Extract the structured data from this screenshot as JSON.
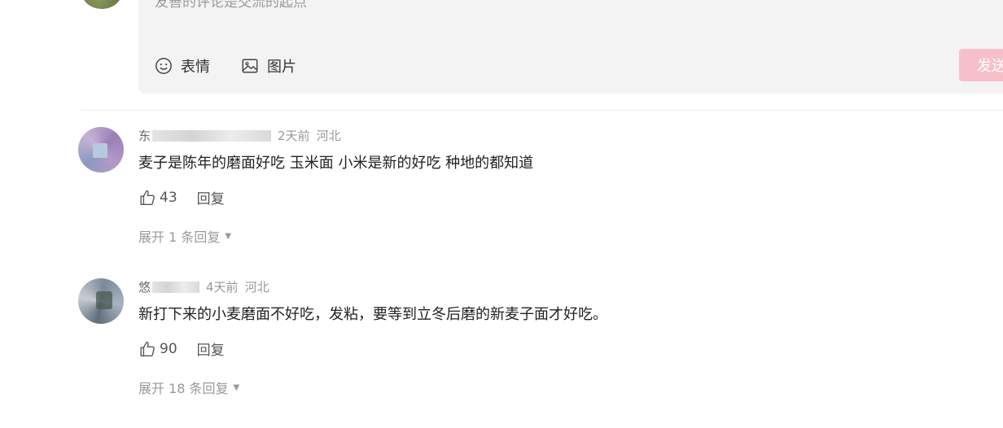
{
  "editor": {
    "placeholder": "友善的评论是交流的起点",
    "tools": [
      {
        "icon": "emoji-icon",
        "label": "表情"
      },
      {
        "icon": "image-icon",
        "label": "图片"
      }
    ],
    "send_label": "发送"
  },
  "comments": [
    {
      "username": "东",
      "time": "2天前",
      "location": "河北",
      "text": "麦子是陈年的磨面好吃 玉米面 小米是新的好吃 种地的都知道",
      "likes": "43",
      "reply_label": "回复",
      "expand_label": "展开 1 条回复"
    },
    {
      "username": "悠",
      "time": "4天前",
      "location": "河北",
      "text": "新打下来的小麦磨面不好吃，发粘，要等到立冬后磨的新麦子面才好吃。",
      "likes": "90",
      "reply_label": "回复",
      "expand_label": "展开 18 条回复"
    }
  ]
}
